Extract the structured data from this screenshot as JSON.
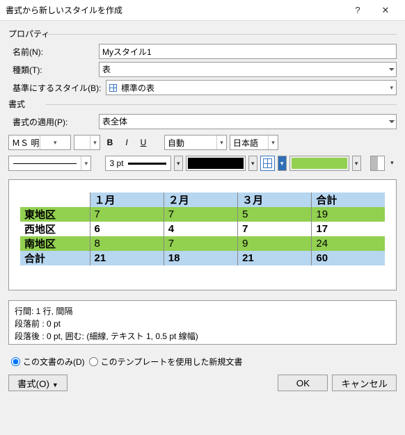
{
  "title": "書式から新しいスタイルを作成",
  "sections": {
    "properties": "プロパティ",
    "format": "書式"
  },
  "labels": {
    "name": "名前(N):",
    "type": "種類(T):",
    "base": "基準にするスタイル(B):",
    "apply": "書式の適用(P):"
  },
  "values": {
    "name": "Myスタイル1",
    "type": "表",
    "base": "標準の表",
    "apply": "表全体"
  },
  "font": {
    "name": "ＭＳ 明朝 (本文",
    "size": "",
    "color": "自動",
    "lang": "日本語"
  },
  "fmt": {
    "bold": "B",
    "italic": "I",
    "underline": "U"
  },
  "border": {
    "weight": "3 pt"
  },
  "table": {
    "headers": [
      "",
      "１月",
      "２月",
      "３月",
      "合計"
    ],
    "rows": [
      {
        "cells": [
          "東地区",
          "7",
          "7",
          "5",
          "19"
        ],
        "style": "r-green"
      },
      {
        "cells": [
          "西地区",
          "6",
          "4",
          "7",
          "17"
        ],
        "style": "r-white"
      },
      {
        "cells": [
          "南地区",
          "8",
          "7",
          "9",
          "24"
        ],
        "style": "r-green"
      },
      {
        "cells": [
          "合計",
          "21",
          "18",
          "21",
          "60"
        ],
        "style": "r-total"
      }
    ]
  },
  "info": {
    "l1": "行間:  1 行, 間隔",
    "l2": "段落前 :  0 pt",
    "l3": "段落後 :  0 pt, 囲む: (細線, テキスト 1,  0.5 pt 線幅)"
  },
  "radio": {
    "thisdoc": "この文書のみ(D)",
    "template": "このテンプレートを使用した新規文書"
  },
  "buttons": {
    "format": "書式(O)",
    "ok": "OK",
    "cancel": "キャンセル"
  }
}
